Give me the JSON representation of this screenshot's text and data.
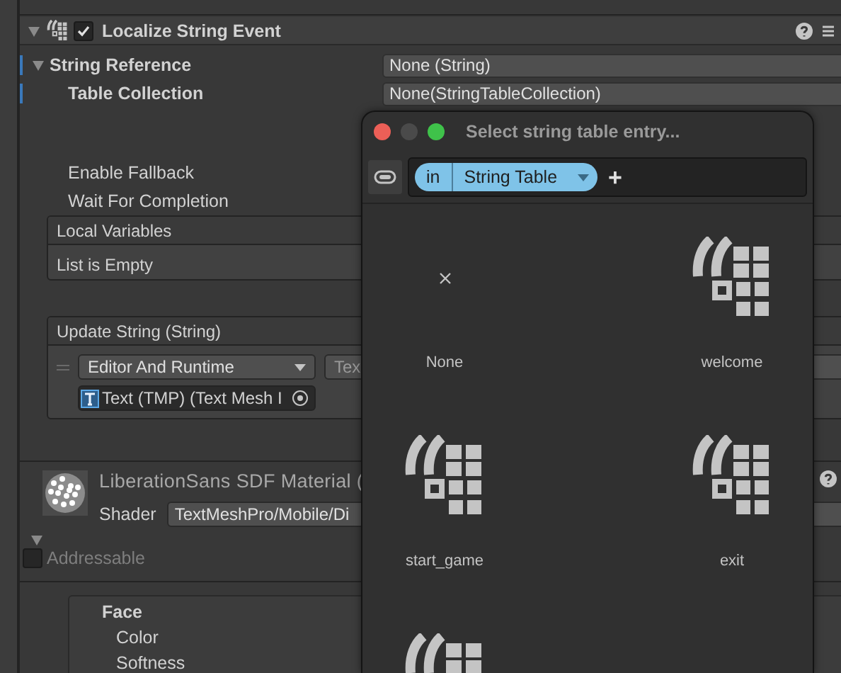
{
  "component": {
    "title": "Localize String Event",
    "enabled": true,
    "expanded": true
  },
  "string_reference": {
    "label": "String Reference",
    "expanded": true,
    "value": "None (String)",
    "table_collection": {
      "label": "Table Collection",
      "value": "None(StringTableCollection)"
    },
    "enable_fallback": {
      "label": "Enable Fallback"
    },
    "wait_for_completion": {
      "label": "Wait For Completion"
    },
    "local_variables": {
      "title": "Local Variables",
      "empty_text": "List is Empty"
    }
  },
  "update_string": {
    "title": "Update String (String)",
    "mode": "Editor And Runtime",
    "function": "Tex",
    "target": "Text (TMP) (Text Mesh I"
  },
  "material": {
    "name": "LiberationSans SDF Material (",
    "expanded": true,
    "shader_label": "Shader",
    "shader": "TextMeshPro/Mobile/Di",
    "addressable": {
      "label": "Addressable",
      "checked": false
    }
  },
  "face": {
    "title": "Face",
    "properties": [
      "Color",
      "Softness"
    ]
  },
  "picker": {
    "title": "Select string table entry...",
    "filter": {
      "prefix": "in",
      "value": "String Table"
    },
    "add": "+",
    "entries": [
      {
        "kind": "none",
        "label": "None"
      },
      {
        "kind": "entry",
        "label": "welcome"
      },
      {
        "kind": "entry",
        "label": "start_game"
      },
      {
        "kind": "entry",
        "label": "exit"
      },
      {
        "kind": "entry"
      }
    ]
  }
}
